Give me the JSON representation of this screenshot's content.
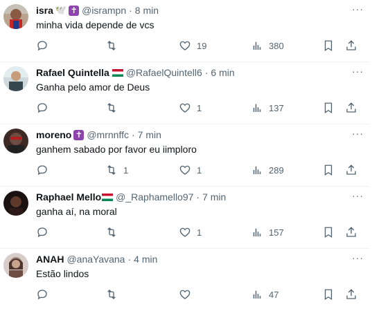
{
  "tweets": [
    {
      "name": "isra",
      "badges": [
        "🕊️",
        "✝️"
      ],
      "handle": "@isrampn",
      "time": "8 min",
      "text": "minha vida depende de vcs",
      "replies": "",
      "retweets": "",
      "likes": "19",
      "views": "380"
    },
    {
      "name": "Rafael Quintella",
      "badges": [
        "flag"
      ],
      "handle": "@RafaelQuintell6",
      "time": "6 min",
      "text": "Ganha pelo amor de Deus",
      "replies": "",
      "retweets": "",
      "likes": "1",
      "views": "137"
    },
    {
      "name": "moreno",
      "badges": [
        "✝️"
      ],
      "handle": "@mrnnffc",
      "time": "7 min",
      "text": "ganhem sabado por favor eu iimploro",
      "replies": "",
      "retweets": "1",
      "likes": "1",
      "views": "289"
    },
    {
      "name": "Raphael Mello",
      "badges": [
        "flag"
      ],
      "handle": "@_Raphamello97",
      "time": "7 min",
      "text": "ganha aí, na moral",
      "replies": "",
      "retweets": "",
      "likes": "1",
      "views": "157"
    },
    {
      "name": "ANAH",
      "badges": [],
      "handle": "@anaYavana",
      "time": "4 min",
      "text": "Estão lindos",
      "replies": "",
      "retweets": "",
      "likes": "",
      "views": "47"
    }
  ],
  "separator": "·",
  "colors": {
    "text": "#0f1419",
    "secondary": "#536471",
    "divider": "#eff3f4",
    "flag_red": "#c8102e",
    "flag_green": "#008751",
    "cross_purple": "#8e44ad"
  }
}
